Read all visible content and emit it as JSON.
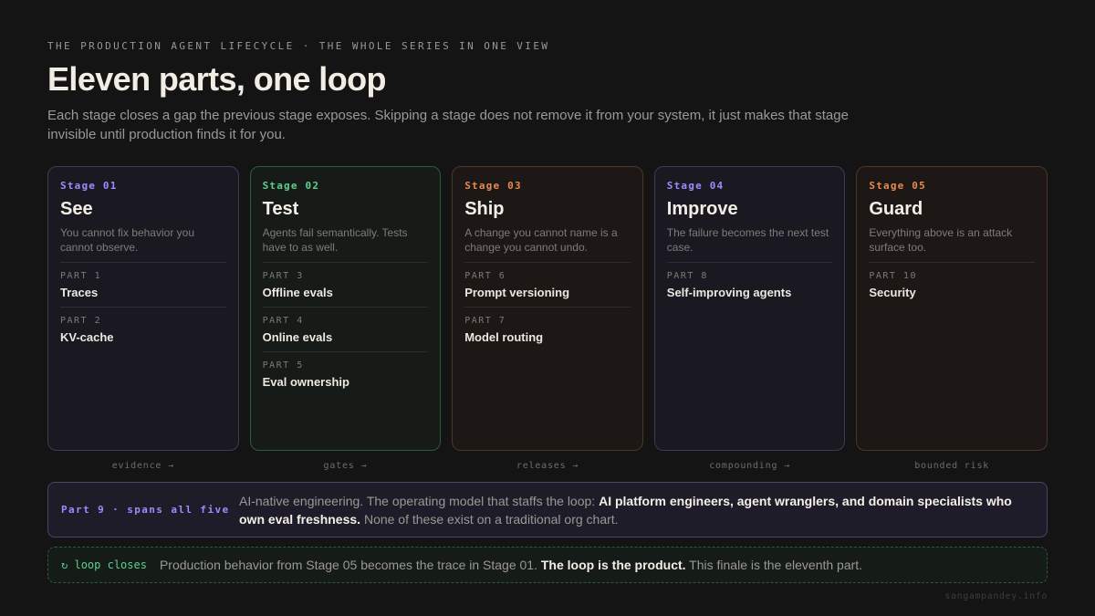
{
  "header": {
    "eyebrow": "THE PRODUCTION AGENT LIFECYCLE · THE WHOLE SERIES IN ONE VIEW",
    "title": "Eleven parts, one loop",
    "subtitle": "Each stage closes a gap the previous stage exposes. Skipping a stage does not remove it from your system, it just makes that stage invisible until production finds it for you."
  },
  "colors": {
    "purple": "#9f8bff",
    "green": "#5fcf8f",
    "orange": "#e8894e"
  },
  "stages": [
    {
      "num": "Stage 01",
      "name": "See",
      "color": "purple",
      "desc": "You cannot fix behavior you cannot observe.",
      "parts": [
        {
          "no": "PART 1",
          "name": "Traces"
        },
        {
          "no": "PART 2",
          "name": "KV-cache"
        }
      ]
    },
    {
      "num": "Stage 02",
      "name": "Test",
      "color": "green",
      "desc": "Agents fail semantically. Tests have to as well.",
      "parts": [
        {
          "no": "PART 3",
          "name": "Offline evals"
        },
        {
          "no": "PART 4",
          "name": "Online evals"
        },
        {
          "no": "PART 5",
          "name": "Eval ownership"
        }
      ]
    },
    {
      "num": "Stage 03",
      "name": "Ship",
      "color": "orange",
      "desc": "A change you cannot name is a change you cannot undo.",
      "parts": [
        {
          "no": "PART 6",
          "name": "Prompt versioning"
        },
        {
          "no": "PART 7",
          "name": "Model routing"
        }
      ]
    },
    {
      "num": "Stage 04",
      "name": "Improve",
      "color": "purple",
      "desc": "The failure becomes the next test case.",
      "parts": [
        {
          "no": "PART 8",
          "name": "Self-improving agents"
        }
      ]
    },
    {
      "num": "Stage 05",
      "name": "Guard",
      "color": "orange",
      "desc": "Everything above is an attack surface too.",
      "parts": [
        {
          "no": "PART 10",
          "name": "Security"
        }
      ]
    }
  ],
  "flow_labels": [
    "evidence →",
    "gates →",
    "releases →",
    "compounding →",
    "bounded risk"
  ],
  "part9": {
    "tag": "Part 9 · spans all five",
    "text_lead": "AI-native engineering. The operating model that staffs the loop: ",
    "text_bold": "AI platform engineers, agent wranglers, and domain specialists who own eval freshness.",
    "text_tail": " None of these exist on a traditional org chart."
  },
  "loop": {
    "icon": "↻",
    "tag": "loop closes",
    "text_lead": "Production behavior from Stage 05 becomes the trace in Stage 01. ",
    "text_bold": "The loop is the product.",
    "text_tail": " This finale is the eleventh part."
  },
  "credit": "sangampandey.info"
}
